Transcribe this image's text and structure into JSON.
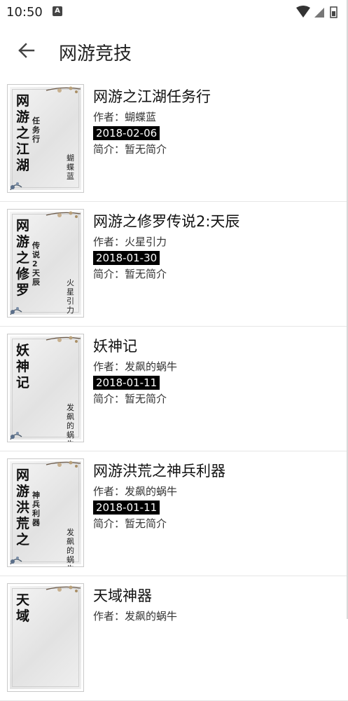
{
  "status_bar": {
    "time": "10:50",
    "notification_icon": "A"
  },
  "app_bar": {
    "title": "网游竞技",
    "back_icon": "arrow-left-icon"
  },
  "labels": {
    "author_prefix": "作者：",
    "intro_prefix": "简介："
  },
  "books": [
    {
      "title": "网游之江湖任务行",
      "author": "蝴蝶蓝",
      "date": "2018-02-06",
      "intro": "暂无简介",
      "cover": {
        "main": "网游之江湖",
        "sub": "任务行",
        "author": "蝴蝶蓝"
      }
    },
    {
      "title": "网游之修罗传说2:天辰",
      "author": "火星引力",
      "date": "2018-01-30",
      "intro": "暂无简介",
      "cover": {
        "main": "网游之修罗",
        "sub": "传说2天辰",
        "author": "火星引力"
      }
    },
    {
      "title": "妖神记",
      "author": "发飙的蜗牛",
      "date": "2018-01-11",
      "intro": "暂无简介",
      "cover": {
        "main": "妖神记",
        "sub": "",
        "author": "发飙的蜗牛"
      }
    },
    {
      "title": "网游洪荒之神兵利器",
      "author": "发飙的蜗牛",
      "date": "2018-01-11",
      "intro": "暂无简介",
      "cover": {
        "main": "网游洪荒之",
        "sub": "神兵利器",
        "author": "发飙的蜗牛"
      }
    },
    {
      "title": "天域神器",
      "author": "发飙的蜗牛",
      "date": "",
      "intro": "",
      "cover": {
        "main": "天域",
        "sub": "",
        "author": ""
      }
    }
  ]
}
